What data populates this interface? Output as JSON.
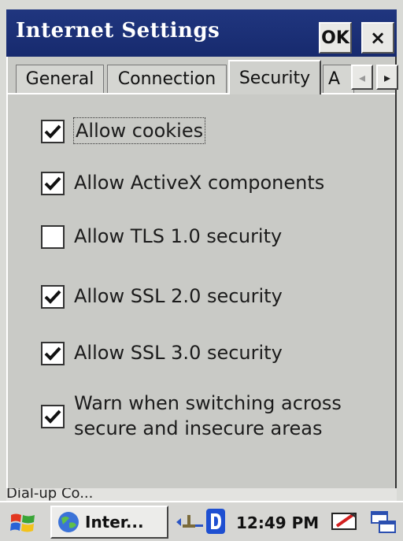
{
  "window": {
    "title": "Internet Settings",
    "ok_label": "OK",
    "close_label": "×"
  },
  "tabs": [
    {
      "label": "General"
    },
    {
      "label": "Connection"
    },
    {
      "label": "Security",
      "selected": true
    },
    {
      "label": "A"
    }
  ],
  "tab_scroll": {
    "left": "◂",
    "right": "▸"
  },
  "options": [
    {
      "label": "Allow cookies",
      "checked": true
    },
    {
      "label": "Allow ActiveX components",
      "checked": true
    },
    {
      "label": "Allow TLS 1.0 security",
      "checked": false
    },
    {
      "label": "Allow SSL 2.0 security",
      "checked": true
    },
    {
      "label": "Allow SSL 3.0 security",
      "checked": true
    },
    {
      "label_line1": "Warn when switching across",
      "label_line2": "secure and insecure areas",
      "checked": true
    }
  ],
  "statusline": "Dial-up Co...",
  "taskbar": {
    "task_label": "Inter...",
    "clock": "12:49 PM"
  },
  "colors": {
    "titlebar": "#1b2f74",
    "dialog_bg": "#c9cac6"
  }
}
